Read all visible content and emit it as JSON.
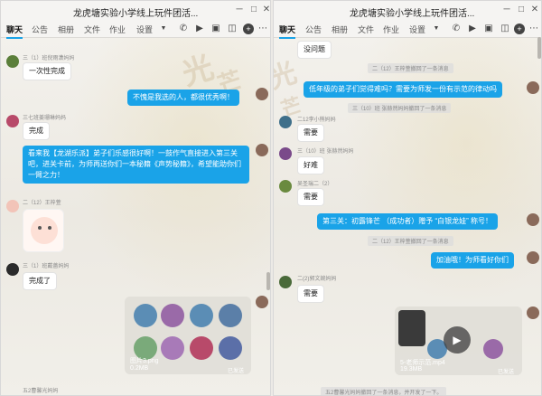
{
  "left": {
    "title": "龙虎塘实验小学线上玩件团活...",
    "tabs": [
      "聊天",
      "公告",
      "相册",
      "文件",
      "作业",
      "设置"
    ],
    "messages": {
      "m1_name": "三（1）班倪雨潇妈妈",
      "m1_text": "一次性完成",
      "m2_text": "不愧是我选的人，都很优秀啊！",
      "m3_name": "三七班姜珊琳妈妈",
      "m3_text": "完成",
      "m4_text": "看来我【龙湖乐派】弟子们乐感很好啊！一鼓作气直接进入第三关吧，进关卡前，为师再送你们一本秘籍《声势秘籍》，希望能助你们一臂之力！",
      "m5_name": "二（12）王梓萱",
      "m6_name": "三（1）班戴蔷妈妈",
      "m6_text": "完成了",
      "m7_file": "图片3.png",
      "m7_size": "0.2MB",
      "m7_status": "已发送",
      "m8_name": "五2曹馨光妈妈"
    }
  },
  "right": {
    "title": "龙虎塘实验小学线上玩件团活...",
    "tabs": [
      "聊天",
      "公告",
      "相册",
      "文件",
      "作业",
      "设置"
    ],
    "messages": {
      "r1_text": "没问题",
      "r2_sys": "二（12）王梓萱撤回了一条消息",
      "r3_text": "低年级的弟子们觉得难吗？需要为师发一份有示范的律动吗",
      "r4_sys": "三（10）班 张赫然妈妈撤回了一条消息",
      "r5_name": "二12李小熊妈妈",
      "r5_text": "需要",
      "r6_name": "三（10）班 张赫然妈妈",
      "r6_text": "好难",
      "r7_name": "吴圣瑞二（2）",
      "r7_text": "需要",
      "r8_text": "第三关：初露锋芒 （成功者）赠予 “白银龙娃” 称号！",
      "r9_sys": "二（12）王梓萱撤回了一条消息",
      "r10_text": "加油哦！为师看好你们",
      "r11_name": "二(2)郭文婉妈妈",
      "r11_text": "需要",
      "r12_file": "5-老师示范.mp4",
      "r12_size": "19.3MB",
      "r12_status": "已发送",
      "r13_sys": "五2曹馨光妈妈撤回了一条消息，并开发了一下。"
    }
  },
  "colors": {
    "accent": "#1aa3e8",
    "bubble_gray": "#ffffff"
  }
}
